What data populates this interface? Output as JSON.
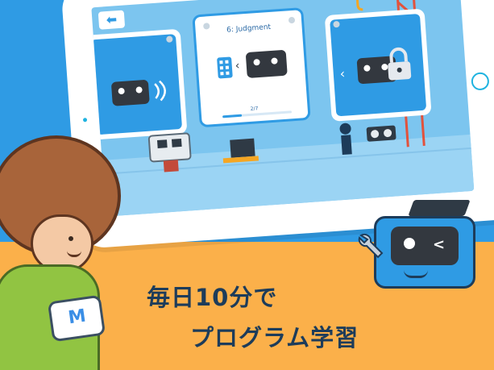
{
  "app": {
    "back_icon": "back-arrow-icon",
    "cards": [
      {
        "id": "left",
        "title": "",
        "locked": false
      },
      {
        "id": "center",
        "title": "6: Judgment",
        "progress": "2/7",
        "progress_value": 0.28
      },
      {
        "id": "right",
        "title": "",
        "locked": true,
        "lock_icon": "lock-icon"
      }
    ]
  },
  "headline": {
    "line1": "毎日10分で",
    "line2": "プログラム学習"
  },
  "colors": {
    "sky": "#2f9be4",
    "background": "#fbb04a",
    "text": "#1d3c5a"
  }
}
